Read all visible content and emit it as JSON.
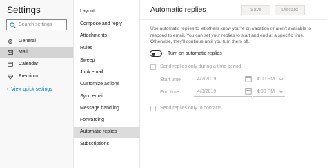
{
  "sidebar": {
    "title": "Settings",
    "search_placeholder": "Search settings",
    "items": [
      {
        "label": "General",
        "icon": "gear-icon"
      },
      {
        "label": "Mail",
        "icon": "mail-icon"
      },
      {
        "label": "Calendar",
        "icon": "calendar-icon"
      },
      {
        "label": "Premium",
        "icon": "diamond-icon"
      }
    ],
    "selected": "Mail",
    "view_quick_settings": "View quick settings"
  },
  "mail_menu": {
    "items": [
      "Layout",
      "Compose and reply",
      "Attachments",
      "Rules",
      "Sweep",
      "Junk email",
      "Customize actions",
      "Sync email",
      "Message handling",
      "Forwarding",
      "Automatic replies",
      "Subscriptions"
    ],
    "selected": "Automatic replies"
  },
  "pane": {
    "title": "Automatic replies",
    "save_label": "Save",
    "discard_label": "Discard",
    "description": "Use automatic replies to let others know you're on vacation or aren't available to respond to email. You can set your replies to start and end at a specific time. Otherwise, they'll continue until you turn them off.",
    "toggle_label": "Turn on automatic replies",
    "toggle_on": false,
    "time_period_label": "Send replies only during a time period",
    "start_label": "Start time",
    "start_date": "4/2/2019",
    "start_time": "4:00 PM",
    "end_label": "End time",
    "end_date": "4/3/2019",
    "end_time": "4:00 PM",
    "contacts_only_label": "Send replies only to contacts"
  },
  "colors": {
    "accent": "#0078d4",
    "sidebar_bg": "#f8f8f8",
    "selected_bg": "#d4d4d4",
    "disabled_text": "#a19f9d"
  }
}
